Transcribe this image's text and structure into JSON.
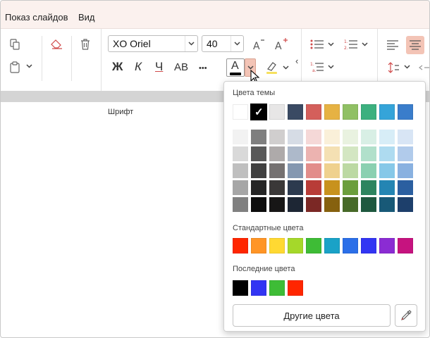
{
  "menubar": {
    "items": [
      "Показ слайдов",
      "Вид"
    ]
  },
  "font": {
    "family": "XO Oriel",
    "size": "40",
    "group_label": "Шрифт"
  },
  "format": {
    "bold": "Ж",
    "italic": "К",
    "underline": "Ч",
    "case": "AB",
    "more": "•••",
    "font_color_letter": "A"
  },
  "popup": {
    "theme_title": "Цвета темы",
    "standard_title": "Стандартные цвета",
    "recent_title": "Последние цвета",
    "other_button": "Другие цвета",
    "theme_colors": [
      "#ffffff",
      "#000000",
      "#e7e6e6",
      "#3a4a63",
      "#d45f5b",
      "#e6b243",
      "#90c064",
      "#3cb07f",
      "#35a4d9",
      "#3a7dcb"
    ],
    "theme_selected_index": 1,
    "shades": [
      [
        "#f2f2f2",
        "#7f7f7f",
        "#d0cece",
        "#d6dce5",
        "#f5d8d7",
        "#faf0d9",
        "#e9f2e0",
        "#d8efe5",
        "#d7edf7",
        "#d8e5f5"
      ],
      [
        "#d9d9d9",
        "#595959",
        "#aeaaaa",
        "#adb9ca",
        "#ecb3b0",
        "#f4e0b3",
        "#d3e6c2",
        "#b1e0cb",
        "#aedbf0",
        "#b1cbeb"
      ],
      [
        "#bfbfbf",
        "#404040",
        "#757171",
        "#8497b0",
        "#e28d8a",
        "#efd18e",
        "#bcd9a3",
        "#8ad0b1",
        "#86c8e8",
        "#89b1e0"
      ],
      [
        "#a6a6a6",
        "#262626",
        "#3a3838",
        "#2c3a4e",
        "#b83c37",
        "#c8921d",
        "#6b9e3c",
        "#2d845f",
        "#2485b3",
        "#2b5fa0"
      ],
      [
        "#808080",
        "#0d0d0d",
        "#171616",
        "#1d2634",
        "#7b2825",
        "#86610f",
        "#476a28",
        "#1e583f",
        "#185977",
        "#1d3f6b"
      ]
    ],
    "standard_colors": [
      "#ff2600",
      "#ff9526",
      "#ffd932",
      "#a5d82a",
      "#3ebc36",
      "#1aa2c7",
      "#2b6fe8",
      "#3235f3",
      "#8b2cd3",
      "#c6137f"
    ],
    "recent_colors": [
      "#000000",
      "#3235f3",
      "#3ebc36",
      "#ff2600"
    ]
  }
}
